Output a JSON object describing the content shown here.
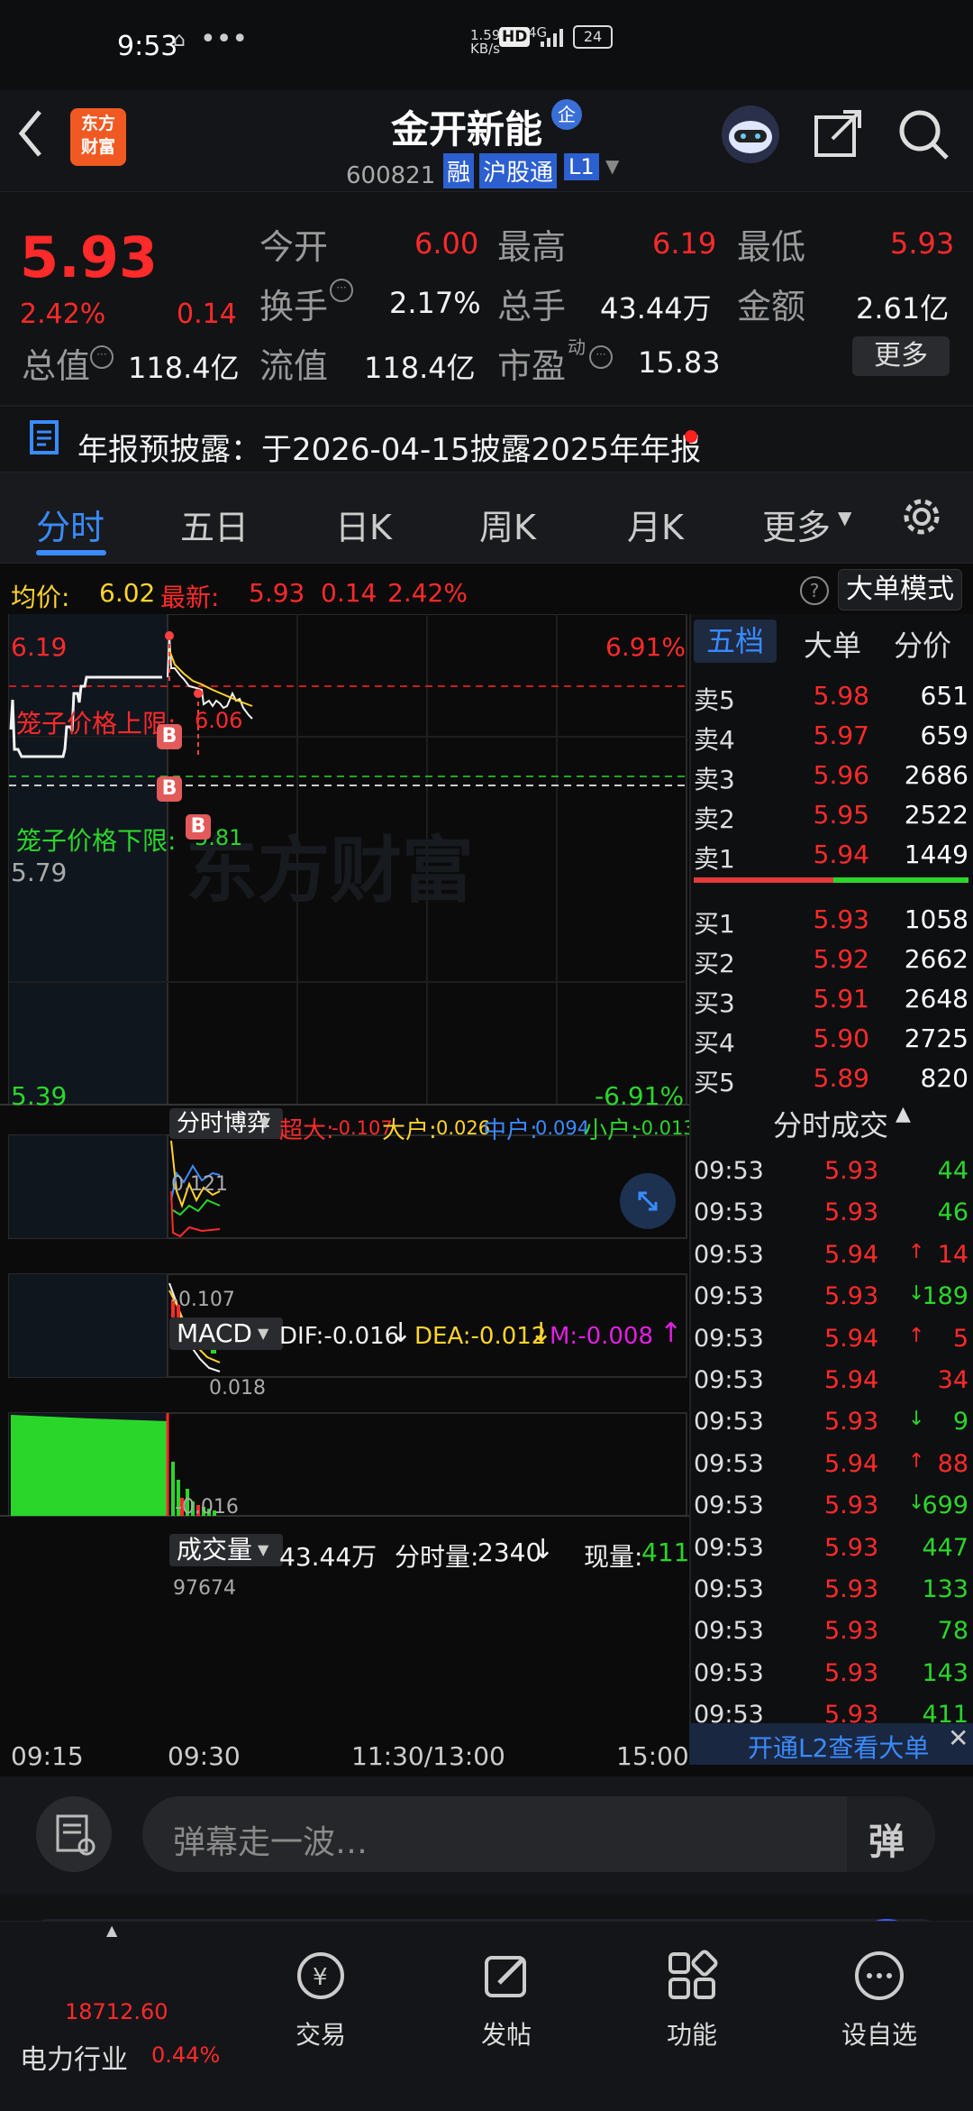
{
  "status": {
    "time": "9:53",
    "net_speed": "1.59",
    "net_unit": "KB/s",
    "hd": "HD",
    "signal": "4G",
    "battery": "24"
  },
  "header": {
    "logo_line1": "东方",
    "logo_line2": "财富",
    "title": "金开新能",
    "title_badge": "企",
    "code": "600821",
    "tag_rong": "融",
    "tag_hgt": "沪股通",
    "tag_l1": "L1",
    "colors": {
      "accent": "#3a8bff",
      "up": "#ff2a2a",
      "down": "#2bd62b"
    }
  },
  "quote": {
    "price": "5.93",
    "pct": "2.42%",
    "change": "0.14",
    "open_label": "今开",
    "open": "6.00",
    "high_label": "最高",
    "high": "6.19",
    "low_label": "最低",
    "low": "5.93",
    "turnover_label": "换手",
    "turnover": "2.17%",
    "volume_label": "总手",
    "volume": "43.44万",
    "amount_label": "金额",
    "amount": "2.61亿",
    "mktcap_label": "总值",
    "mktcap": "118.4亿",
    "float_label": "流值",
    "float": "118.4亿",
    "pe_label": "市盈",
    "pe_dyn": "动",
    "pe": "15.83",
    "more": "更多"
  },
  "notice": {
    "text": "年报预披露：于2026-04-15披露2025年年报"
  },
  "tabs": [
    "分时",
    "五日",
    "日K",
    "周K",
    "月K",
    "更多"
  ],
  "chart": {
    "avg_label": "均价:",
    "avg": "6.02",
    "latest_label": "最新:",
    "latest": "5.93",
    "latest_chg": "0.14",
    "latest_pct": "2.42%",
    "mode_button": "大单模式",
    "y_top": "6.19",
    "y_top_pct": "6.91%",
    "y_bottom": "5.39",
    "y_bottom_pct": "-6.91%",
    "y_mid": "5.79",
    "upper_limit_label": "笼子价格上限:",
    "upper_limit": "6.06",
    "lower_limit_label": "笼子价格下限:",
    "lower_limit": "5.81",
    "b_marker": "B",
    "watermark": "东方财富",
    "flow": {
      "selector": "分时博弈",
      "super_label": "超大:",
      "super": "-0.107",
      "large_label": "大户:",
      "large": "0.026",
      "mid_label": "中户:",
      "mid": "0.094",
      "small_label": "小户:",
      "small": "-0.013",
      "top": "0.121",
      "bottom": "-0.107"
    },
    "macd": {
      "selector": "MACD",
      "dif": "DIF:-0.016",
      "dea": "DEA:-0.012",
      "m": "M:-0.008",
      "top": "0.018",
      "bottom": "-0.016"
    },
    "vol": {
      "selector": "成交量",
      "total": "43.44万",
      "minute_label": "分时量:",
      "minute": "2340",
      "now_label": "现量:",
      "now": "411",
      "max": "97674"
    },
    "time_axis": [
      "09:15",
      "09:30",
      "11:30/13:00",
      "15:00"
    ]
  },
  "orderbook": {
    "tabs": [
      "五档",
      "大单",
      "分价"
    ],
    "asks": [
      {
        "label": "卖5",
        "price": "5.98",
        "vol": "651"
      },
      {
        "label": "卖4",
        "price": "5.97",
        "vol": "659"
      },
      {
        "label": "卖3",
        "price": "5.96",
        "vol": "2686"
      },
      {
        "label": "卖2",
        "price": "5.95",
        "vol": "2522"
      },
      {
        "label": "卖1",
        "price": "5.94",
        "vol": "1449"
      }
    ],
    "bids": [
      {
        "label": "买1",
        "price": "5.93",
        "vol": "1058"
      },
      {
        "label": "买2",
        "price": "5.92",
        "vol": "2662"
      },
      {
        "label": "买3",
        "price": "5.91",
        "vol": "2648"
      },
      {
        "label": "买4",
        "price": "5.90",
        "vol": "2725"
      },
      {
        "label": "买5",
        "price": "5.89",
        "vol": "820"
      }
    ],
    "trades_title": "分时成交",
    "trades": [
      {
        "t": "09:53",
        "p": "5.93",
        "a": "",
        "v": "44",
        "pc": "red",
        "vc": "green"
      },
      {
        "t": "09:53",
        "p": "5.93",
        "a": "",
        "v": "46",
        "pc": "red",
        "vc": "green"
      },
      {
        "t": "09:53",
        "p": "5.94",
        "a": "↑",
        "v": "14",
        "pc": "red",
        "vc": "red"
      },
      {
        "t": "09:53",
        "p": "5.93",
        "a": "↓",
        "v": "189",
        "pc": "red",
        "vc": "green"
      },
      {
        "t": "09:53",
        "p": "5.94",
        "a": "↑",
        "v": "5",
        "pc": "red",
        "vc": "red"
      },
      {
        "t": "09:53",
        "p": "5.94",
        "a": "",
        "v": "34",
        "pc": "red",
        "vc": "red"
      },
      {
        "t": "09:53",
        "p": "5.93",
        "a": "↓",
        "v": "9",
        "pc": "red",
        "vc": "green"
      },
      {
        "t": "09:53",
        "p": "5.94",
        "a": "↑",
        "v": "88",
        "pc": "red",
        "vc": "red"
      },
      {
        "t": "09:53",
        "p": "5.93",
        "a": "↓",
        "v": "699",
        "pc": "red",
        "vc": "green"
      },
      {
        "t": "09:53",
        "p": "5.93",
        "a": "",
        "v": "447",
        "pc": "red",
        "vc": "green"
      },
      {
        "t": "09:53",
        "p": "5.93",
        "a": "",
        "v": "133",
        "pc": "red",
        "vc": "green"
      },
      {
        "t": "09:53",
        "p": "5.93",
        "a": "",
        "v": "78",
        "pc": "red",
        "vc": "green"
      },
      {
        "t": "09:53",
        "p": "5.93",
        "a": "",
        "v": "143",
        "pc": "red",
        "vc": "green"
      },
      {
        "t": "09:53",
        "p": "5.93",
        "a": "",
        "v": "411",
        "pc": "red",
        "vc": "green"
      }
    ],
    "l2_banner": "开通L2查看大单"
  },
  "danmu": {
    "placeholder": "弹幕走一波…",
    "send": "弹"
  },
  "bottomnav": {
    "index_value": "18712.60",
    "index_name": "电力行业",
    "index_pct": "0.44%",
    "items": [
      "交易",
      "发帖",
      "功能",
      "设自选"
    ]
  }
}
